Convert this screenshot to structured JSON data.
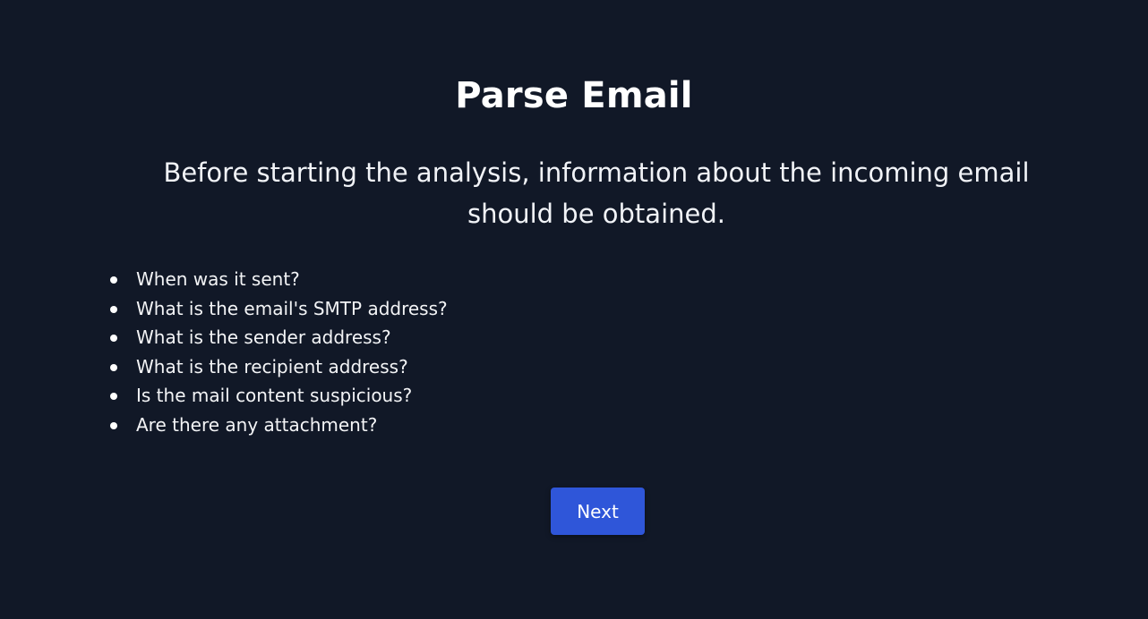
{
  "page": {
    "title": "Parse Email",
    "subtitle": "Before starting the analysis, information about the incoming email should be obtained.",
    "questions": [
      "When was it sent?",
      "What is the email's SMTP address?",
      "What is the sender address?",
      "What is the recipient address?",
      "Is the mail content suspicious?",
      "Are there any attachment?"
    ],
    "next_label": "Next"
  },
  "colors": {
    "background": "#111827",
    "text": "#ffffff",
    "button": "#2f56d9"
  }
}
